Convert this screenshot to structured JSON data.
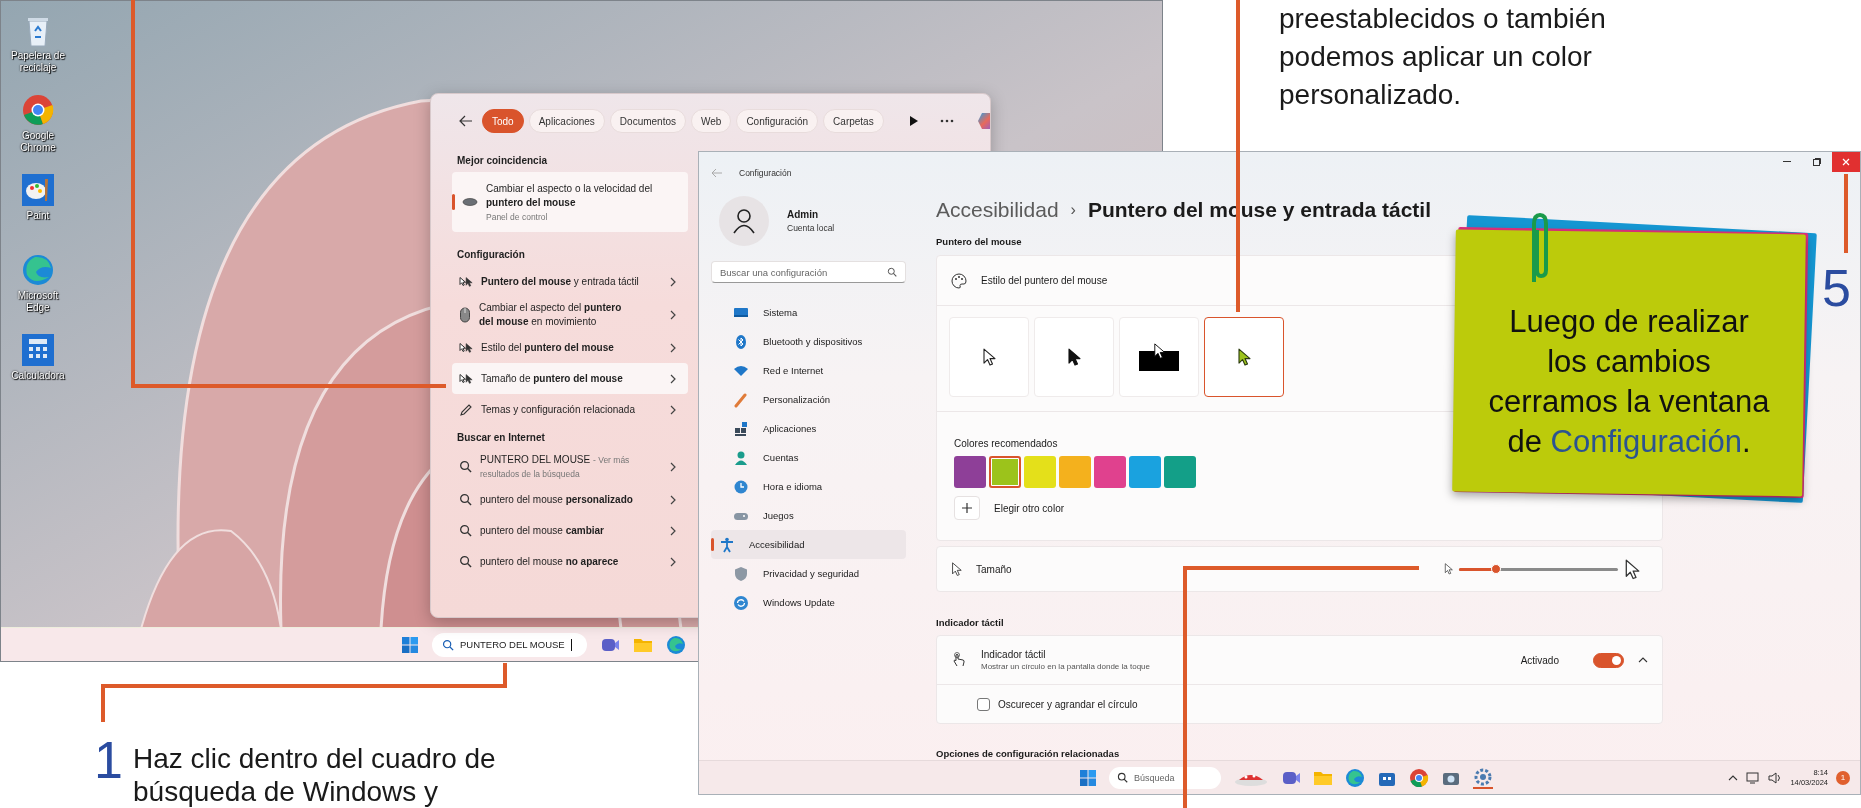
{
  "desktop": {
    "icons": [
      {
        "kind": "recycle",
        "label": "Papelera de reciclaje"
      },
      {
        "kind": "chrome",
        "label": "Google Chrome"
      },
      {
        "kind": "paint",
        "label": "Paint"
      },
      {
        "kind": "edge",
        "label": "Microsoft Edge"
      },
      {
        "kind": "calculator",
        "label": "Calculadora"
      }
    ],
    "taskbar": {
      "search_value": "PUNTERO DEL MOUSE"
    }
  },
  "search_panel": {
    "filters": [
      {
        "label": "Todo",
        "selected": true
      },
      {
        "label": "Aplicaciones",
        "selected": false
      },
      {
        "label": "Documentos",
        "selected": false
      },
      {
        "label": "Web",
        "selected": false
      },
      {
        "label": "Configuración",
        "selected": false
      },
      {
        "label": "Carpetas",
        "selected": false
      }
    ],
    "best_match": {
      "heading": "Mejor coincidencia",
      "title": "Cambiar el aspecto o la velocidad del **puntero del mouse**",
      "subtitle": "Panel de control"
    },
    "sections": [
      {
        "heading": "Configuración",
        "items": [
          {
            "kind": "pointer",
            "text": "**Puntero del mouse** y entrada táctil",
            "selected": false
          },
          {
            "kind": "mouse",
            "text": "Cambiar el aspecto del **puntero del mouse** en movimiento",
            "selected": false
          },
          {
            "kind": "pointer",
            "text": "Estilo del **puntero del mouse**",
            "selected": false
          },
          {
            "kind": "pointer",
            "text": "Tamaño de **puntero del mouse**",
            "selected": true
          },
          {
            "kind": "theme",
            "text": "Temas y configuración relacionada",
            "selected": false
          }
        ]
      },
      {
        "heading": "Buscar en Internet",
        "items": [
          {
            "kind": "search",
            "text": "PUNTERO DEL MOUSE",
            "detail": "- Ver más resultados de la búsqueda",
            "selected": false
          },
          {
            "kind": "search",
            "text": "puntero del mouse **personalizado**",
            "selected": false
          },
          {
            "kind": "search",
            "text": "puntero del mouse **cambiar**",
            "selected": false
          },
          {
            "kind": "search",
            "text": "puntero del mouse **no aparece**",
            "selected": false
          }
        ]
      }
    ]
  },
  "settings": {
    "title": "Configuración",
    "user": {
      "name": "Admin",
      "account": "Cuenta local"
    },
    "search": {
      "placeholder": "Buscar una configuración"
    },
    "nav": [
      {
        "kind": "system",
        "label": "Sistema",
        "selected": false
      },
      {
        "kind": "bluetooth",
        "label": "Bluetooth y dispositivos",
        "selected": false
      },
      {
        "kind": "network",
        "label": "Red e Internet",
        "selected": false
      },
      {
        "kind": "personalization",
        "label": "Personalización",
        "selected": false
      },
      {
        "kind": "apps",
        "label": "Aplicaciones",
        "selected": false
      },
      {
        "kind": "accounts",
        "label": "Cuentas",
        "selected": false
      },
      {
        "kind": "time",
        "label": "Hora e idioma",
        "selected": false
      },
      {
        "kind": "gaming",
        "label": "Juegos",
        "selected": false
      },
      {
        "kind": "accessibility",
        "label": "Accesibilidad",
        "selected": true
      },
      {
        "kind": "privacy",
        "label": "Privacidad y seguridad",
        "selected": false
      },
      {
        "kind": "update",
        "label": "Windows Update",
        "selected": false
      }
    ],
    "breadcrumb": {
      "parent": "Accesibilidad",
      "separator": "›",
      "current": "Puntero del mouse y entrada táctil"
    },
    "pointer": {
      "heading": "Puntero del mouse",
      "style_label": "Estilo del puntero del mouse",
      "styles": [
        {
          "kind": "white",
          "selected": false
        },
        {
          "kind": "black",
          "selected": false
        },
        {
          "kind": "inverted",
          "selected": false
        },
        {
          "kind": "custom",
          "selected": true
        }
      ],
      "colors_label": "Colores recomendados",
      "colors": [
        {
          "color": "#8e3f98",
          "selected": false
        },
        {
          "color": "#9cc31b",
          "selected": true
        },
        {
          "color": "#e4e01a",
          "selected": false
        },
        {
          "color": "#f4b11d",
          "selected": false
        },
        {
          "color": "#e0418e",
          "selected": false
        },
        {
          "color": "#1aa2df",
          "selected": false
        },
        {
          "color": "#139f88",
          "selected": false
        }
      ],
      "custom_color": "Elegir otro color"
    },
    "size": {
      "label": "Tamaño",
      "level": 0.23
    },
    "touch": {
      "heading": "Indicador táctil",
      "title": "Indicador táctil",
      "description": "Mostrar un círculo en la pantalla donde la toque",
      "state": "Activado",
      "on": true,
      "expanded": true,
      "option": {
        "label": "Oscurecer y agrandar el círculo",
        "checked": false
      }
    },
    "related_heading": "Opciones de configuración relacionadas",
    "taskbar": {
      "search_placeholder": "Búsqueda",
      "time": "8:14",
      "date": "14/03/2024",
      "badge": "1"
    }
  },
  "callouts": {
    "top_text": "preestablecidos o también\npodemos aplicar un color\npersonalizado.",
    "step1": {
      "number": "1",
      "text": "Haz clic dentro del cuadro de\nbúsqueda de Windows y"
    },
    "step5": {
      "number": "5"
    },
    "note": {
      "text": "Luego de realizar\nlos cambios\ncerramos la ventana\nde **Configuración**."
    }
  }
}
